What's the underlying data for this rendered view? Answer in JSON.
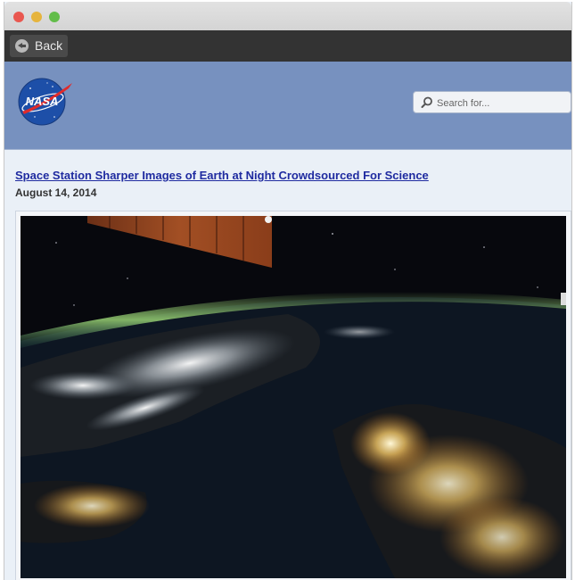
{
  "window": {
    "controls": [
      "close",
      "minimize",
      "maximize"
    ]
  },
  "navbar": {
    "back_label": "Back",
    "back_icon": "back-arrow-circle-icon"
  },
  "header": {
    "logo_text": "NASA",
    "logo_alt": "NASA logo",
    "search": {
      "placeholder": "Search for...",
      "value": "",
      "icon": "search-icon"
    }
  },
  "article": {
    "title": "Space Station Sharper Images of Earth at Night Crowdsourced For Science",
    "date": "August 14, 2014",
    "image_alt": "Night view of Korean peninsula from the International Space Station"
  },
  "colors": {
    "header_bg": "#7791bf",
    "navbar_bg": "#333333",
    "link": "#1f2ba0",
    "page_bg": "#eaf0f7"
  }
}
